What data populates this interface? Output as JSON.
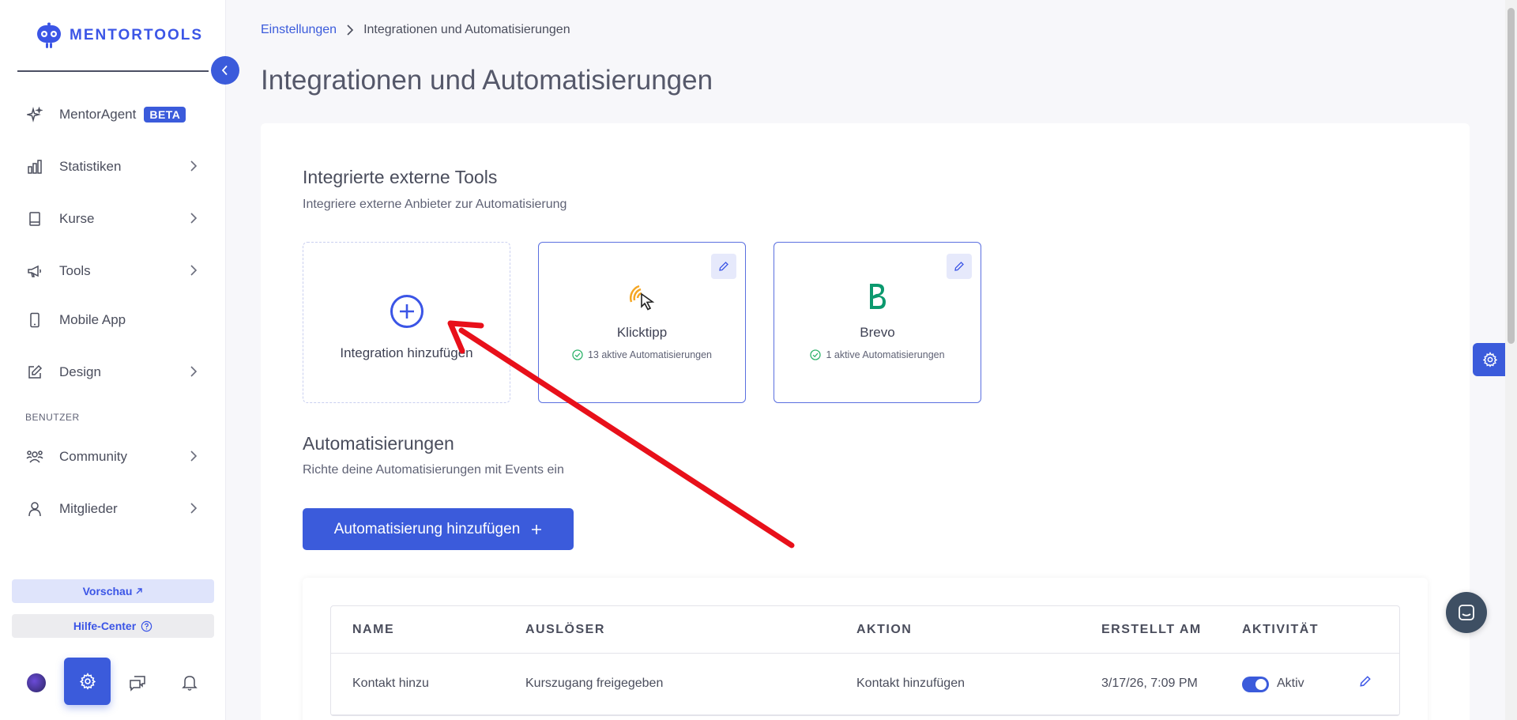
{
  "brand": {
    "name": "MENTORTOOLS",
    "accent": "#3b5bdb"
  },
  "sidebar": {
    "items": [
      {
        "label": "MentorAgent",
        "badge": "BETA",
        "icon": "sparkle-icon"
      },
      {
        "label": "Statistiken",
        "icon": "bar-chart-icon"
      },
      {
        "label": "Kurse",
        "icon": "book-icon"
      },
      {
        "label": "Tools",
        "icon": "megaphone-icon"
      },
      {
        "label": "Mobile App",
        "icon": "smartphone-icon"
      },
      {
        "label": "Design",
        "icon": "edit-icon"
      }
    ],
    "section_label": "BENUTZER",
    "user_items": [
      {
        "label": "Community",
        "icon": "users-icon"
      },
      {
        "label": "Mitglieder",
        "icon": "user-icon"
      }
    ],
    "preview_label": "Vorschau",
    "help_label": "Hilfe-Center"
  },
  "breadcrumb": {
    "parent": "Einstellungen",
    "current": "Integrationen und Automatisierungen"
  },
  "page_title": "Integrationen und Automatisierungen",
  "tools_section": {
    "title": "Integrierte externe Tools",
    "subtitle": "Integriere externe Anbieter zur Automatisierung",
    "add_label": "Integration hinzufügen",
    "integrations": [
      {
        "name": "Klicktipp",
        "status": "13 aktive Automatisierungen"
      },
      {
        "name": "Brevo",
        "status": "1 aktive Automatisierungen"
      }
    ]
  },
  "automations_section": {
    "title": "Automatisierungen",
    "subtitle": "Richte deine Automatisierungen mit Events ein",
    "add_button": "Automatisierung hinzufügen",
    "columns": [
      "NAME",
      "AUSLÖSER",
      "AKTION",
      "ERSTELLT AM",
      "AKTIVITÄT"
    ],
    "rows": [
      {
        "name": "Kontakt hinzu",
        "trigger": "Kurszugang freigegeben",
        "action": "Kontakt hinzufügen",
        "created": "3/17/26, 7:09 PM",
        "activity": "Aktiv",
        "active": true
      }
    ]
  }
}
